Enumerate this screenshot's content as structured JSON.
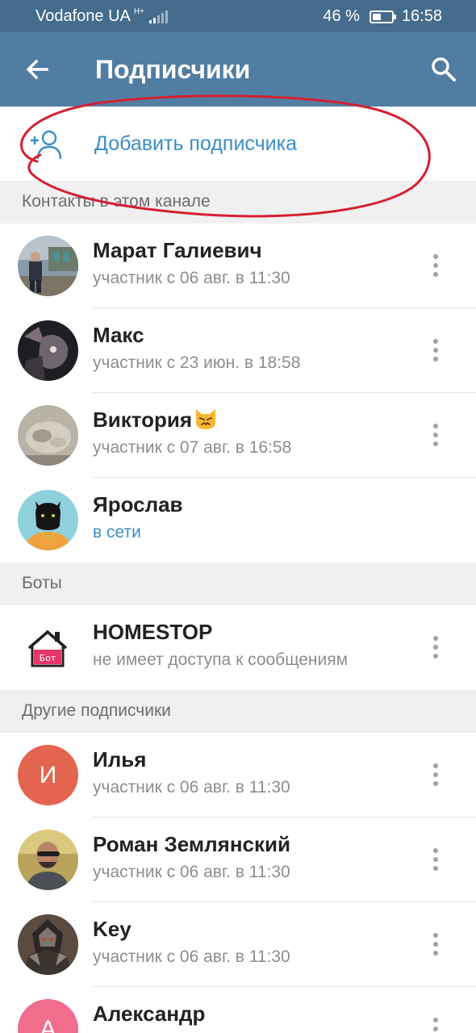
{
  "status_bar": {
    "carrier": "Vodafone UA",
    "network_type": "H+",
    "battery_percent": "46 %",
    "battery_level": 0.46,
    "time": "16:58"
  },
  "header": {
    "title": "Подписчики",
    "back_icon": "arrow-back-icon",
    "search_icon": "search-icon"
  },
  "add_subscriber": {
    "label": "Добавить подписчика",
    "icon": "add-user-icon"
  },
  "sections": {
    "contacts": "Контакты в этом канале",
    "bots": "Боты",
    "others": "Другие подписчики"
  },
  "contacts": [
    {
      "name": "Марат Галиевич",
      "status": "участник с 06 авг. в 11:30"
    },
    {
      "name": "Макс",
      "status": "участник с 23 июн. в 18:58"
    },
    {
      "name": "Виктория",
      "status": "участник с 07 авг. в 16:58"
    },
    {
      "name": "Ярослав",
      "status": "в сети"
    }
  ],
  "bots": [
    {
      "name": "HOMESTOP",
      "status": "не имеет доступа к сообщениям",
      "logo_text": "Бот"
    }
  ],
  "others": [
    {
      "name": "Илья",
      "status": "участник с 06 авг. в 11:30",
      "initial": "И",
      "color": "#e4654f"
    },
    {
      "name": "Роман Землянский",
      "status": "участник с 06 авг. в 11:30"
    },
    {
      "name": "Key",
      "status": "участник с 06 авг. в 11:30"
    },
    {
      "name": "Александр",
      "status": "",
      "initial": "А",
      "color": "#f06d8c"
    }
  ],
  "colors": {
    "header": "#517da2",
    "status_bar": "#456c8c",
    "accent": "#3a8ec6",
    "annotation": "#d42031"
  }
}
